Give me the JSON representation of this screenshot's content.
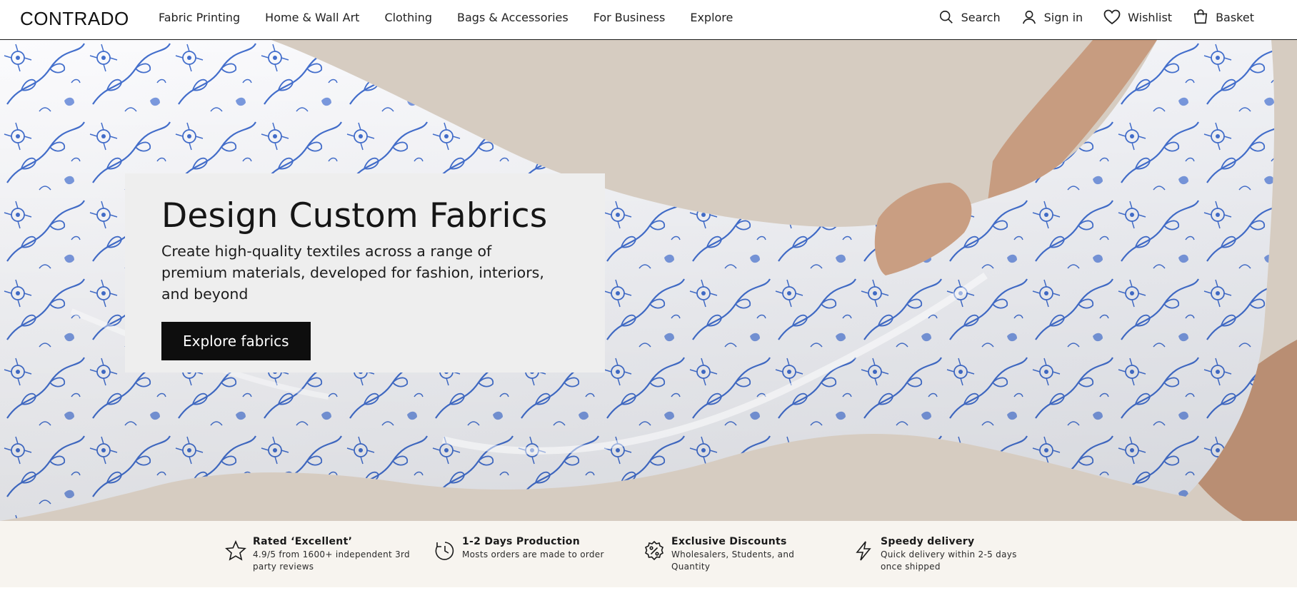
{
  "brand": {
    "logo": "CONTRADO"
  },
  "nav": {
    "items": [
      {
        "label": "Fabric Printing"
      },
      {
        "label": "Home & Wall Art"
      },
      {
        "label": "Clothing"
      },
      {
        "label": "Bags & Accessories"
      },
      {
        "label": "For Business"
      },
      {
        "label": "Explore"
      }
    ]
  },
  "utility": {
    "search": "Search",
    "signin": "Sign in",
    "wishlist": "Wishlist",
    "basket": "Basket"
  },
  "hero": {
    "title": "Design Custom Fabrics",
    "subtitle": "Create high-quality textiles across a range of premium materials, developed for fashion, interiors, and beyond",
    "cta": "Explore fabrics",
    "image": "floral-blue-white-fabric-photo"
  },
  "features": [
    {
      "icon": "star-icon",
      "title": "Rated ‘Excellent’",
      "desc": "4.9/5 from 1600+ independent 3rd party reviews"
    },
    {
      "icon": "clock-icon",
      "title": "1-2 Days Production",
      "desc": "Mosts orders are made to order"
    },
    {
      "icon": "discount-icon",
      "title": "Exclusive Discounts",
      "desc": "Wholesalers, Students, and Quantity"
    },
    {
      "icon": "lightning-icon",
      "title": "Speedy delivery",
      "desc": "Quick delivery within 2-5 days once shipped"
    }
  ],
  "colors": {
    "accent": "#2f5fc7",
    "button": "#0e0e0e",
    "strip": "#f7f4ef"
  }
}
